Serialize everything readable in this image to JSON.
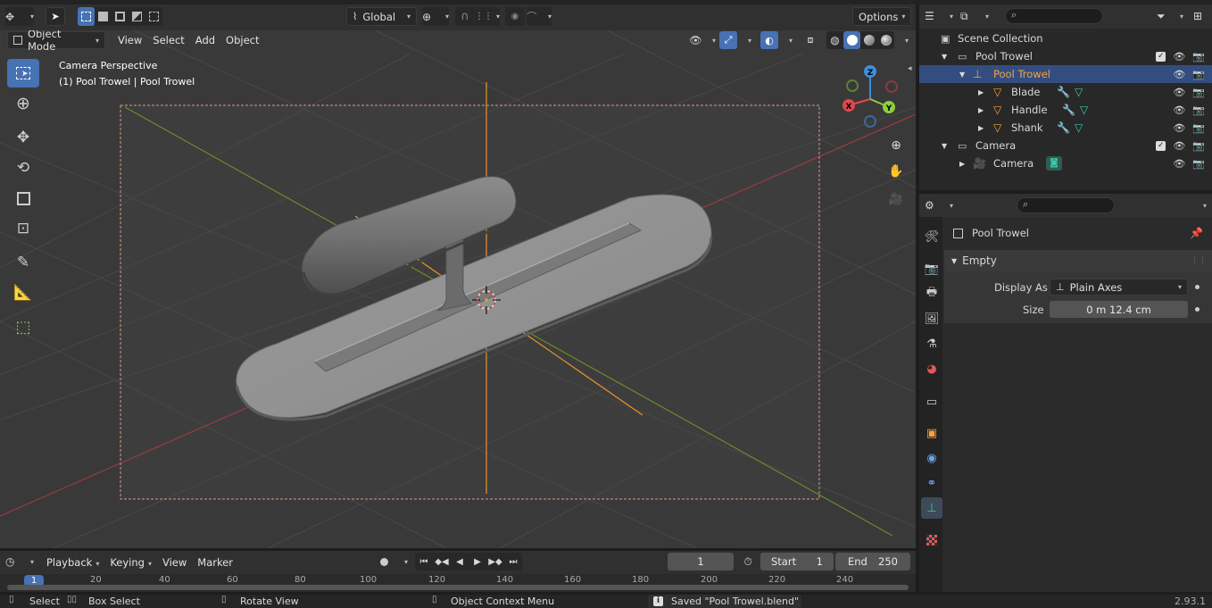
{
  "topbar": {
    "orientation": "Global",
    "options_label": "Options"
  },
  "viewport_header": {
    "mode_label": "Object Mode",
    "menus": [
      "View",
      "Select",
      "Add",
      "Object"
    ]
  },
  "viewport": {
    "view_name": "Camera Perspective",
    "object_info": "(1) Pool Trowel | Pool Trowel",
    "gizmo": {
      "z": "Z",
      "y": "Y",
      "x": "X"
    }
  },
  "outliner": {
    "rows": [
      {
        "label": "Scene Collection",
        "type": "scene"
      },
      {
        "label": "Pool Trowel",
        "type": "collection"
      },
      {
        "label": "Pool Trowel",
        "type": "empty",
        "selected": true
      },
      {
        "label": "Blade",
        "type": "mesh"
      },
      {
        "label": "Handle",
        "type": "mesh"
      },
      {
        "label": "Shank",
        "type": "mesh"
      },
      {
        "label": "Camera",
        "type": "collection"
      },
      {
        "label": "Camera",
        "type": "camera"
      }
    ]
  },
  "properties": {
    "object_name": "Pool Trowel",
    "panel_title": "Empty",
    "display_as_label": "Display As",
    "display_as_value": "Plain Axes",
    "size_label": "Size",
    "size_value": "0 m 12.4 cm"
  },
  "timeline": {
    "menus": [
      "Playback",
      "Keying",
      "View",
      "Marker"
    ],
    "current_frame": "1",
    "start_label": "Start",
    "start_value": "1",
    "end_label": "End",
    "end_value": "250",
    "ruler_current": "1",
    "ruler_ticks": [
      "20",
      "40",
      "60",
      "80",
      "100",
      "120",
      "140",
      "160",
      "180",
      "200",
      "220",
      "240"
    ]
  },
  "statusbar": {
    "select": "Select",
    "box_select": "Box Select",
    "rotate_view": "Rotate View",
    "context_menu": "Object Context Menu",
    "message": "Saved \"Pool Trowel.blend\"",
    "version": "2.93.1"
  },
  "colors": {
    "accent": "#4772b3",
    "selected_object": "#f5a33c",
    "x_axis": "#e6464d",
    "y_axis": "#8ccf3c",
    "z_axis": "#3b8fe0"
  }
}
